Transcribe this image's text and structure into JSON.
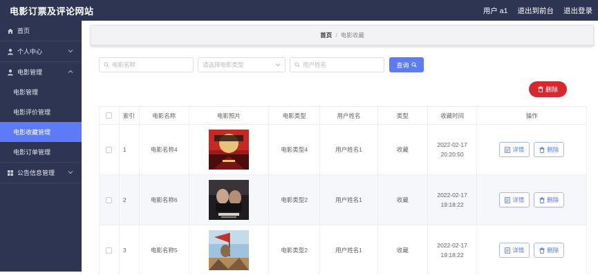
{
  "header": {
    "title": "电影订票及评论网站",
    "user_label": "用户 a1",
    "frontend_label": "退出到前台",
    "logout_label": "退出登录"
  },
  "sidebar": {
    "items": [
      {
        "label": "首页",
        "icon": "home-icon"
      },
      {
        "label": "个人中心",
        "icon": "user-icon",
        "expandable": true
      },
      {
        "label": "电影管理",
        "icon": "user-icon",
        "expandable": true,
        "expanded": true
      },
      {
        "label": "公告信息管理",
        "icon": "grid-icon",
        "expandable": true
      }
    ],
    "sub_items": [
      {
        "label": "电影管理"
      },
      {
        "label": "电影评价管理"
      },
      {
        "label": "电影收藏管理",
        "active": true
      },
      {
        "label": "电影订单管理"
      }
    ]
  },
  "breadcrumb": {
    "home": "首页",
    "separator": "/",
    "current": "电影收藏"
  },
  "search": {
    "movie_name_placeholder": "电影名称",
    "movie_type_placeholder": "请选择电影类型",
    "user_name_placeholder": "用户姓名",
    "query_label": "查询"
  },
  "actions": {
    "delete_label": "删除"
  },
  "table": {
    "columns": [
      "索引",
      "电影名称",
      "电影照片",
      "电影类型",
      "用户姓名",
      "类型",
      "收藏时间",
      "操作"
    ],
    "rows": [
      {
        "index": "1",
        "movie_name": "电影名称4",
        "movie_type": "电影类型4",
        "user_name": "用户姓名1",
        "category": "收藏",
        "time": "2022-02-17 20:20:50",
        "poster": "poster-red"
      },
      {
        "index": "2",
        "movie_name": "电影名称6",
        "movie_type": "电影类型2",
        "user_name": "用户姓名1",
        "category": "收藏",
        "time": "2022-02-17 19:18:22",
        "poster": "poster-dark"
      },
      {
        "index": "3",
        "movie_name": "电影名称5",
        "movie_type": "电影类型2",
        "user_name": "用户姓名1",
        "category": "收藏",
        "time": "2022-02-17 19:18:22",
        "poster": "poster-sky"
      }
    ],
    "detail_label": "详情",
    "row_delete_label": "删除"
  },
  "colors": {
    "sidebar_bg": "#2d3553",
    "accent": "#5d7bf7",
    "danger": "#d9272e"
  }
}
